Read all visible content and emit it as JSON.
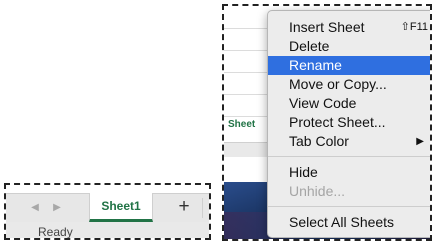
{
  "statusbar": {
    "ready_text": "Ready"
  },
  "sheet_tabs": {
    "active_tab": "Sheet1",
    "add_sheet": "+",
    "prev_arrow": "◀",
    "next_arrow": "▶"
  },
  "context_menu": {
    "items": [
      {
        "label": "Insert Sheet",
        "shortcut": "⇧F11"
      },
      {
        "label": "Delete"
      },
      {
        "label": "Rename",
        "state": "highlighted"
      },
      {
        "label": "Move or Copy..."
      },
      {
        "label": "View Code"
      },
      {
        "label": "Protect Sheet..."
      },
      {
        "label": "Tab Color",
        "submenu_arrow": "▶"
      },
      {
        "label": "Hide"
      },
      {
        "label": "Unhide...",
        "state": "disabled"
      },
      {
        "label": "Select All Sheets"
      }
    ]
  },
  "background": {
    "partial_tab_label": "Sheet"
  },
  "colors": {
    "accent_green": "#217346",
    "highlight_blue": "#2f6fe0"
  }
}
